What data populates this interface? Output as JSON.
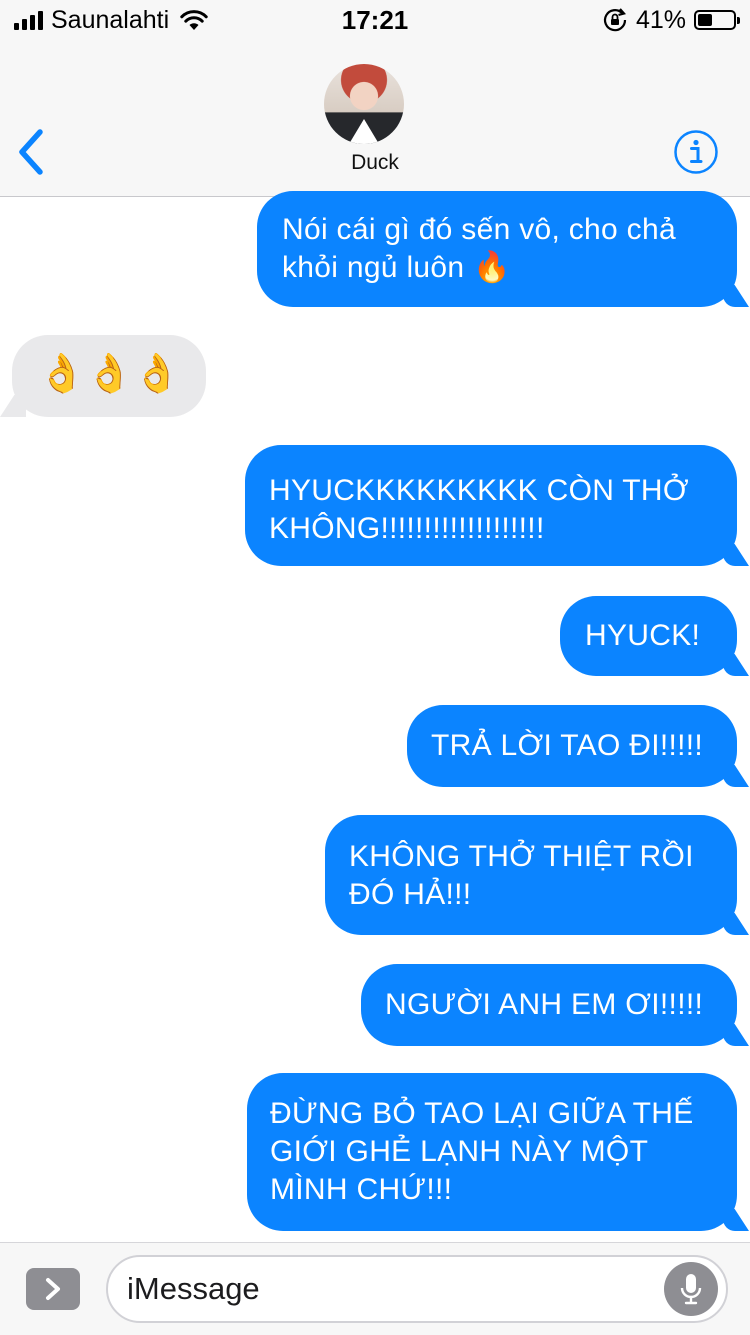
{
  "status_bar": {
    "carrier": "Saunalahti",
    "time": "17:21",
    "battery_percent": "41%",
    "battery_level": 0.41,
    "signal_icon": "signal-bars-icon",
    "wifi_icon": "wifi-icon",
    "rotation_lock_icon": "rotation-lock-icon"
  },
  "header": {
    "contact_name": "Duck",
    "back_icon": "chevron-left-icon",
    "info_icon": "info-icon",
    "accent_color": "#0b84ff"
  },
  "messages": [
    {
      "direction": "outgoing",
      "text_lines": [
        "Nói cái gì đó sến vô, cho chả",
        "khỏi ngủ luôn 🔥"
      ]
    },
    {
      "direction": "incoming",
      "text_lines": [
        "👌👌👌"
      ]
    },
    {
      "direction": "outgoing",
      "text_lines": [
        "HYUCKKKKKKKKK CÒN THỞ",
        "KHÔNG!!!!!!!!!!!!!!!!!!!"
      ]
    },
    {
      "direction": "outgoing",
      "text_lines": [
        "HYUCK!"
      ]
    },
    {
      "direction": "outgoing",
      "text_lines": [
        "TRẢ LỜI TAO ĐI!!!!!"
      ]
    },
    {
      "direction": "outgoing",
      "text_lines": [
        "KHÔNG THỞ THIỆT RỒI",
        "ĐÓ HẢ!!!"
      ]
    },
    {
      "direction": "outgoing",
      "text_lines": [
        "NGƯỜI ANH EM ƠI!!!!!"
      ]
    },
    {
      "direction": "outgoing",
      "text_lines": [
        "ĐỪNG BỎ TAO LẠI GIỮA THẾ",
        "GIỚI GHẺ LẠNH NÀY MỘT",
        "MÌNH CHỨ!!!"
      ]
    }
  ],
  "input_bar": {
    "placeholder": "iMessage",
    "apps_icon": "chevron-right-icon",
    "mic_icon": "microphone-icon"
  }
}
